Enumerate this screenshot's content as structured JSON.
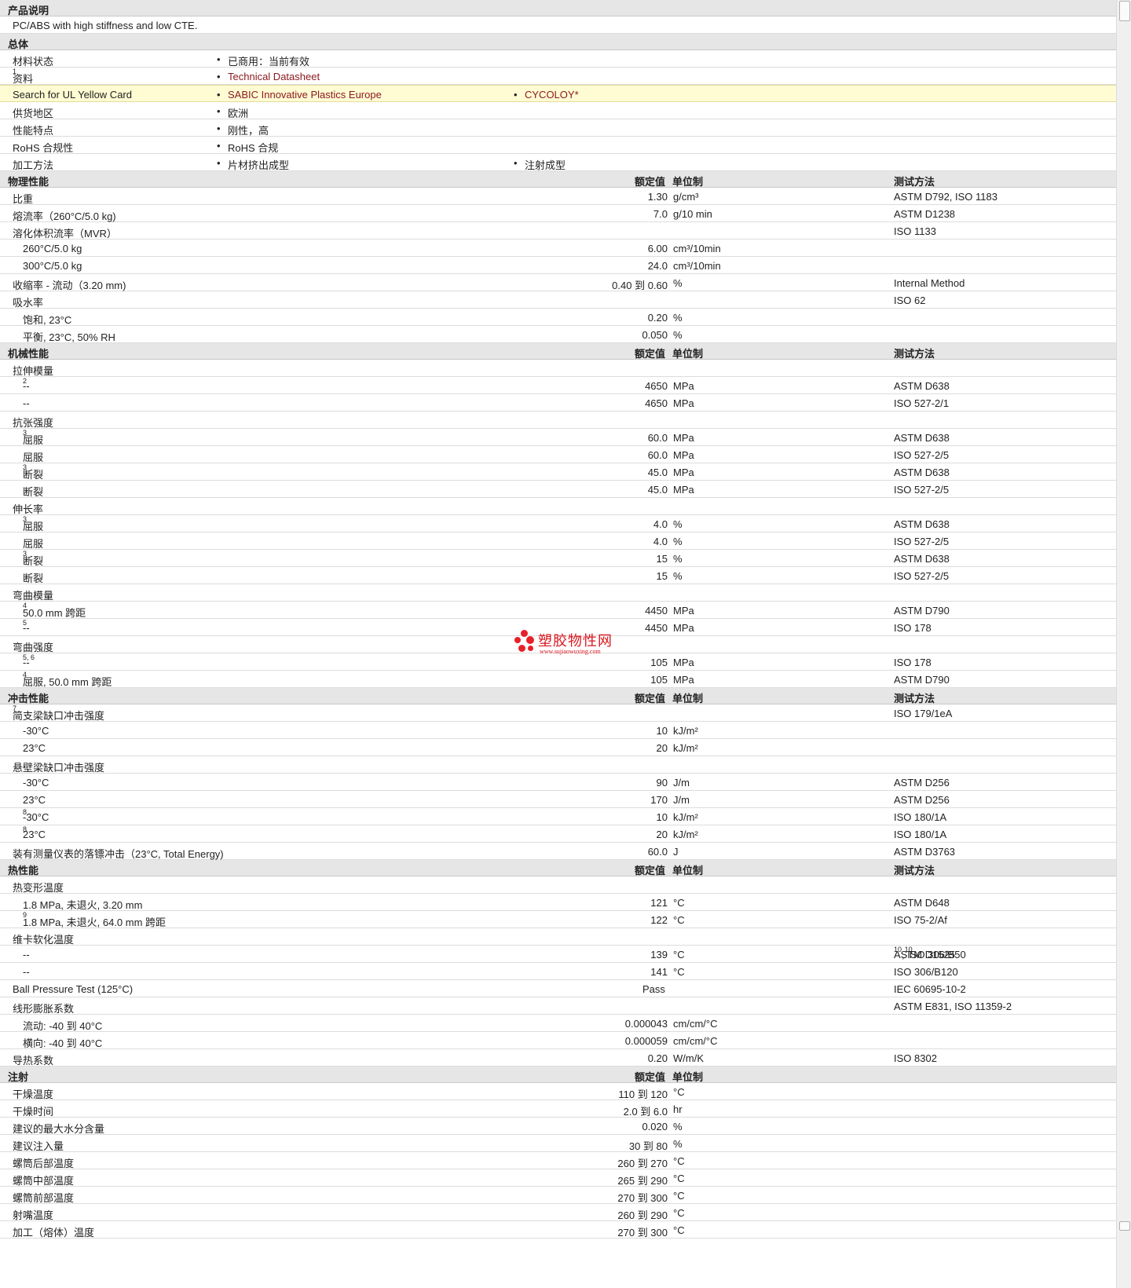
{
  "sections": [
    {
      "title": "产品说明",
      "rows": [
        {
          "label": "PC/ABS with high stiffness and low CTE.",
          "style": "note"
        }
      ]
    },
    {
      "title": "总体",
      "rows": [
        {
          "label": "材料状态",
          "b1": "已商用：当前有效"
        },
        {
          "label": "资料",
          "sup": "1",
          "b1": "Technical Datasheet",
          "b1link": true
        },
        {
          "label": "Search for UL Yellow Card",
          "b1": "SABIC Innovative Plastics Europe",
          "b1link": true,
          "b2": "CYCOLOY*",
          "b2link": true,
          "highlight": true
        },
        {
          "label": "供货地区",
          "b1": "欧洲"
        },
        {
          "label": "性能特点",
          "b1": "刚性，高"
        },
        {
          "label": "RoHS 合规性",
          "b1": "RoHS 合规"
        },
        {
          "label": "加工方法",
          "b1": "片材挤出成型",
          "b2": "注射成型"
        }
      ]
    },
    {
      "title": "物理性能",
      "hv": "额定值",
      "hu": "单位制",
      "hm": "测试方法",
      "rows": [
        {
          "label": "比重",
          "v": "1.30",
          "u": "g/cm³",
          "m": "ASTM D792, ISO 1183"
        },
        {
          "label": "熔流率（260°C/5.0 kg)",
          "v": "7.0",
          "u": "g/10 min",
          "m": "ASTM D1238"
        },
        {
          "label": "溶化体积流率（MVR）",
          "m": "ISO 1133"
        },
        {
          "label": "260°C/5.0 kg",
          "sub": true,
          "v": "6.00",
          "u": "cm³/10min"
        },
        {
          "label": "300°C/5.0 kg",
          "sub": true,
          "v": "24.0",
          "u": "cm³/10min"
        },
        {
          "label": "收缩率 - 流动（3.20 mm)",
          "v": "0.40 到  0.60",
          "u": "%",
          "m": "Internal Method"
        },
        {
          "label": "吸水率",
          "m": "ISO 62"
        },
        {
          "label": "饱和, 23°C",
          "sub": true,
          "v": "0.20",
          "u": "%"
        },
        {
          "label": "平衡, 23°C, 50% RH",
          "sub": true,
          "v": "0.050",
          "u": "%"
        }
      ]
    },
    {
      "title": "机械性能",
      "hv": "额定值",
      "hu": "单位制",
      "hm": "测试方法",
      "rows": [
        {
          "label": "拉伸模量"
        },
        {
          "label": "--",
          "sub": true,
          "sup": "2",
          "v": "4650",
          "u": "MPa",
          "m": "ASTM D638"
        },
        {
          "label": "--",
          "sub": true,
          "v": "4650",
          "u": "MPa",
          "m": "ISO 527-2/1"
        },
        {
          "label": "抗张强度"
        },
        {
          "label": "屈服",
          "sub": true,
          "sup": "3",
          "v": "60.0",
          "u": "MPa",
          "m": "ASTM D638"
        },
        {
          "label": "屈服",
          "sub": true,
          "v": "60.0",
          "u": "MPa",
          "m": "ISO 527-2/5"
        },
        {
          "label": "断裂",
          "sub": true,
          "sup": "3",
          "v": "45.0",
          "u": "MPa",
          "m": "ASTM D638"
        },
        {
          "label": "断裂",
          "sub": true,
          "v": "45.0",
          "u": "MPa",
          "m": "ISO 527-2/5"
        },
        {
          "label": "伸长率"
        },
        {
          "label": "屈服",
          "sub": true,
          "sup": "3",
          "v": "4.0",
          "u": "%",
          "m": "ASTM D638"
        },
        {
          "label": "屈服",
          "sub": true,
          "v": "4.0",
          "u": "%",
          "m": "ISO 527-2/5"
        },
        {
          "label": "断裂",
          "sub": true,
          "sup": "3",
          "v": "15",
          "u": "%",
          "m": "ASTM D638"
        },
        {
          "label": "断裂",
          "sub": true,
          "v": "15",
          "u": "%",
          "m": "ISO 527-2/5"
        },
        {
          "label": "弯曲模量"
        },
        {
          "label": "50.0 mm 跨距",
          "sub": true,
          "sup": "4",
          "v": "4450",
          "u": "MPa",
          "m": "ASTM D790"
        },
        {
          "label": "--",
          "sub": true,
          "sup": "5",
          "v": "4450",
          "u": "MPa",
          "m": "ISO 178"
        },
        {
          "label": "弯曲强度"
        },
        {
          "label": "--",
          "sub": true,
          "sup": "5, 6",
          "v": "105",
          "u": "MPa",
          "m": "ISO 178"
        },
        {
          "label": "屈服, 50.0 mm 跨距",
          "sub": true,
          "sup": "4",
          "v": "105",
          "u": "MPa",
          "m": "ASTM D790"
        }
      ]
    },
    {
      "title": "冲击性能",
      "hv": "额定值",
      "hu": "单位制",
      "hm": "测试方法",
      "rows": [
        {
          "label": "简支梁缺口冲击强度",
          "sup": "7",
          "m": "ISO 179/1eA"
        },
        {
          "label": "-30°C",
          "sub": true,
          "v": "10",
          "u": "kJ/m²"
        },
        {
          "label": "23°C",
          "sub": true,
          "v": "20",
          "u": "kJ/m²"
        },
        {
          "label": "悬壁梁缺口冲击强度"
        },
        {
          "label": "-30°C",
          "sub": true,
          "v": "90",
          "u": "J/m",
          "m": "ASTM D256"
        },
        {
          "label": "23°C",
          "sub": true,
          "v": "170",
          "u": "J/m",
          "m": "ASTM D256"
        },
        {
          "label": "-30°C",
          "sub": true,
          "sup": "8",
          "v": "10",
          "u": "kJ/m²",
          "m": "ISO 180/1A"
        },
        {
          "label": "23°C",
          "sub": true,
          "sup": "8",
          "v": "20",
          "u": "kJ/m²",
          "m": "ISO 180/1A"
        },
        {
          "label": "装有测量仪表的落镖冲击（23°C, Total Energy)",
          "v": "60.0",
          "u": "J",
          "m": "ASTM D3763"
        }
      ]
    },
    {
      "title": "热性能",
      "hv": "额定值",
      "hu": "单位制",
      "hm": "测试方法",
      "rows": [
        {
          "label": "热变形温度"
        },
        {
          "label": "1.8 MPa, 未退火, 3.20 mm",
          "sub": true,
          "v": "121",
          "u": "°C",
          "m": "ASTM D648"
        },
        {
          "label": "1.8 MPa, 未退火, 64.0 mm 跨距",
          "sub": true,
          "sup": "9",
          "v": "122",
          "u": "°C",
          "m": "ISO 75-2/Af"
        },
        {
          "label": "维卡软化温度"
        },
        {
          "label": "--",
          "sub": true,
          "v": "139",
          "u": "°C",
          "m": "ASTM D1525",
          "msup": "10",
          "m2": ", ISO 306/B50",
          "m2sup": "10"
        },
        {
          "label": "--",
          "sub": true,
          "v": "141",
          "u": "°C",
          "m": "ISO 306/B120"
        },
        {
          "label": "Ball Pressure Test (125°C)",
          "vc": "Pass",
          "m": "IEC 60695-10-2"
        },
        {
          "label": "线形膨胀系数",
          "m": "ASTM E831, ISO 11359-2"
        },
        {
          "label": "流动: -40 到  40°C",
          "sub": true,
          "v": "0.000043",
          "u": "cm/cm/°C"
        },
        {
          "label": "横向: -40 到  40°C",
          "sub": true,
          "v": "0.000059",
          "u": "cm/cm/°C"
        },
        {
          "label": "导热系数",
          "v": "0.20",
          "u": "W/m/K",
          "m": "ISO 8302"
        }
      ]
    },
    {
      "title": "注射",
      "hv": "额定值",
      "hu": "单位制",
      "rows": [
        {
          "label": "干燥温度",
          "v": "110 到  120",
          "u": "°C"
        },
        {
          "label": "干燥时间",
          "v": "2.0 到  6.0",
          "u": "hr"
        },
        {
          "label": "建议的最大水分含量",
          "v": "0.020",
          "u": "%"
        },
        {
          "label": "建议注入量",
          "v": "30 到  80",
          "u": "%"
        },
        {
          "label": "螺筒后部温度",
          "v": "260 到  270",
          "u": "°C"
        },
        {
          "label": "螺筒中部温度",
          "v": "265 到  290",
          "u": "°C"
        },
        {
          "label": "螺筒前部温度",
          "v": "270 到  300",
          "u": "°C"
        },
        {
          "label": "射嘴温度",
          "v": "260 到  290",
          "u": "°C"
        },
        {
          "label": "加工（熔体）温度",
          "v": "270 到  300",
          "u": "°C"
        }
      ]
    }
  ],
  "watermark": {
    "cn": "塑胶物性网",
    "en": "www.sujiaowuxing.com"
  },
  "colors": {
    "link": "#8c1b20",
    "section_bg": "#e6e6e6",
    "highlight_bg": "#fffbd3",
    "watermark": "#d9161d"
  }
}
